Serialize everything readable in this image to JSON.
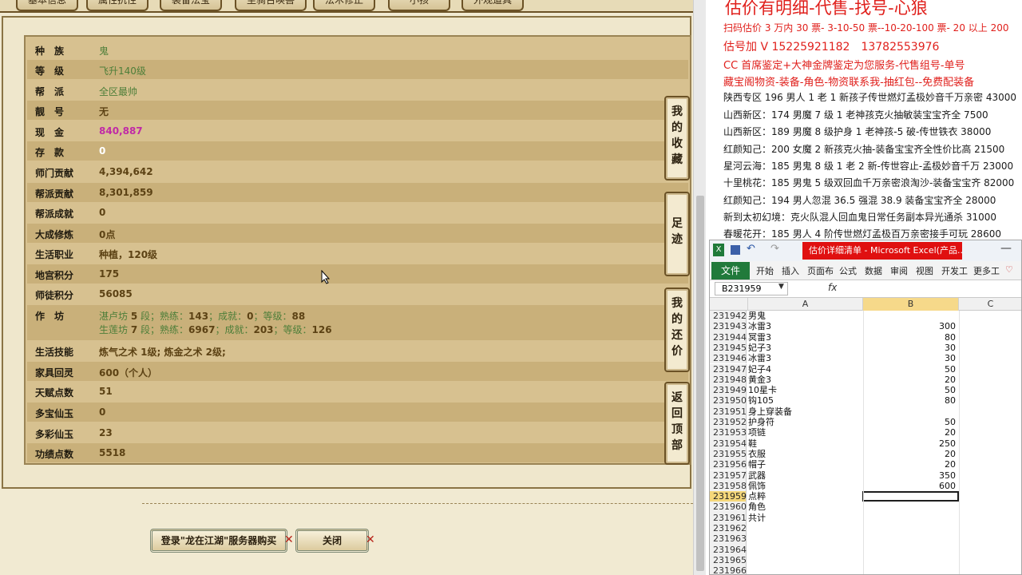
{
  "game": {
    "tabs": [
      "基本信息",
      "属性抗性",
      "装备法宝",
      "坐骑召唤兽",
      "法术修正",
      "小孩",
      "外观道具"
    ],
    "stats": [
      {
        "label": "种　族",
        "value": "鬼",
        "style": "green"
      },
      {
        "label": "等　级",
        "value": "飞升140级",
        "style": "green"
      },
      {
        "label": "帮　派",
        "value": "全区最帅",
        "style": "green"
      },
      {
        "label": "靓　号",
        "value": "无",
        "style": "brown"
      },
      {
        "label": "现　金",
        "value": "840,887",
        "style": "pink"
      },
      {
        "label": "存　款",
        "value": "0",
        "style": "white"
      },
      {
        "label": "师门贡献",
        "value": "4,394,642",
        "style": "brown"
      },
      {
        "label": "帮派贡献",
        "value": "8,301,859",
        "style": "brown"
      },
      {
        "label": "帮派成就",
        "value": "0",
        "style": "brown"
      },
      {
        "label": "大成修炼",
        "value": "0点",
        "style": "brown"
      },
      {
        "label": "生活职业",
        "value": "种植，120级",
        "style": "brown"
      },
      {
        "label": "地宫积分",
        "value": "175",
        "style": "brown"
      },
      {
        "label": "师徒积分",
        "value": "56085",
        "style": "brown"
      }
    ],
    "workshop": {
      "label": "作　坊",
      "line1": {
        "name": "湛卢坊",
        "level": "5",
        "unit": "段；熟练：",
        "skill": "143",
        "ach_label": "；成就：",
        "ach": "0",
        "lv_label": "；等级：",
        "lv": "88"
      },
      "line2": {
        "name": "生莲坊",
        "level": "7",
        "unit": "段；熟练：",
        "skill": "6967",
        "ach_label": "；成就：",
        "ach": "203",
        "lv_label": "；等级：",
        "lv": "126"
      }
    },
    "stats2": [
      {
        "label": "生活技能",
        "value": "炼气之术 1级; 炼金之术 2级;"
      },
      {
        "label": "家具回灵",
        "value": "600（个人）"
      },
      {
        "label": "天赋点数",
        "value": "51"
      },
      {
        "label": "多宝仙玉",
        "value": "0"
      },
      {
        "label": "多彩仙玉",
        "value": "23"
      },
      {
        "label": "功绩点数",
        "value": "5518"
      }
    ],
    "side_buttons": [
      [
        "我",
        "的",
        "收",
        "藏"
      ],
      [
        "足",
        "迹"
      ],
      [
        "我",
        "的",
        "还",
        "价"
      ],
      [
        "返",
        "回",
        "顶",
        "部"
      ]
    ],
    "login_button": "登录\"龙在江湖\"服务器购买",
    "close_button": "关闭"
  },
  "doc": {
    "title": "估价有明细-代售-找号-心狼",
    "red_lines": [
      "扫码估价 3 万内 30 票- 3-10-50 票--10-20-100 票- 20 以上 200",
      "估号加 V 15225921182　13782553976",
      "CC 首席鉴定+大神金牌鉴定为您服务-代售组号-单号",
      "藏宝阁物资-装备-角色-物资联系我-抽红包--免费配装备"
    ],
    "black_lines": [
      "陕西专区 196 男人 1 老 1 新孩子传世燃灯孟极妙音千万亲密 43000",
      "山西新区：174 男魔 7 级 1 老神孩克火抽敏装宝宝齐全 7500",
      "山西新区：189 男魔 8 级护身 1 老神孩-5 破-传世铁衣 38000",
      "红颜知己：200 女魔 2 新孩克火抽-装备宝宝齐全性价比高 21500",
      "星河云海：185 男鬼 8 级 1 老 2 新-传世容止-孟极妙音千万 23000",
      "十里桃花：185 男鬼 5 级双回血千万亲密浪淘沙-装备宝宝齐 82000",
      "红颜知己：194 男人忽混 36.5 强混 38.9 装备宝宝齐全 28000",
      "新到太初幻境：克火队混人回血鬼日常任务副本异光通杀 31000",
      "春暖花开：185 男人 4 阶传世燃灯孟极百万亲密接手可玩 28600"
    ]
  },
  "excel": {
    "window_title": "估价详细清单 - Microsoft Excel(产品...",
    "file_tab": "文件",
    "ribbon_tabs": [
      "开始",
      "插入",
      "页面布",
      "公式",
      "数据",
      "审阅",
      "视图",
      "开发工",
      "更多工"
    ],
    "name_box": "B231959",
    "fx": "fx",
    "col_headers": [
      "A",
      "B",
      "C"
    ],
    "rows": [
      {
        "n": "231942",
        "a": "男鬼",
        "b": ""
      },
      {
        "n": "231943",
        "a": "冰雷3",
        "b": "300"
      },
      {
        "n": "231944",
        "a": "冥雷3",
        "b": "80"
      },
      {
        "n": "231945",
        "a": "妃子3",
        "b": "30"
      },
      {
        "n": "231946",
        "a": "冰雷3",
        "b": "30"
      },
      {
        "n": "231947",
        "a": "妃子4",
        "b": "50"
      },
      {
        "n": "231948",
        "a": "黄金3",
        "b": "20"
      },
      {
        "n": "231949",
        "a": "10星卡",
        "b": "50"
      },
      {
        "n": "231950",
        "a": "钩105",
        "b": "80"
      },
      {
        "n": "231951",
        "a": "身上穿装备",
        "b": ""
      },
      {
        "n": "231952",
        "a": "护身符",
        "b": "50"
      },
      {
        "n": "231953",
        "a": "项链",
        "b": "20"
      },
      {
        "n": "231954",
        "a": "鞋",
        "b": "250"
      },
      {
        "n": "231955",
        "a": "衣服",
        "b": "20"
      },
      {
        "n": "231956",
        "a": "帽子",
        "b": "20"
      },
      {
        "n": "231957",
        "a": "武器",
        "b": "350"
      },
      {
        "n": "231958",
        "a": "佩饰",
        "b": "600"
      },
      {
        "n": "231959",
        "a": "点粹",
        "b": ""
      },
      {
        "n": "231960",
        "a": "角色",
        "b": ""
      },
      {
        "n": "231961",
        "a": "共计",
        "b": ""
      },
      {
        "n": "231962",
        "a": "",
        "b": ""
      },
      {
        "n": "231963",
        "a": "",
        "b": ""
      },
      {
        "n": "231964",
        "a": "",
        "b": ""
      },
      {
        "n": "231965",
        "a": "",
        "b": ""
      },
      {
        "n": "231966",
        "a": "",
        "b": ""
      }
    ],
    "selected_row": "231959"
  }
}
